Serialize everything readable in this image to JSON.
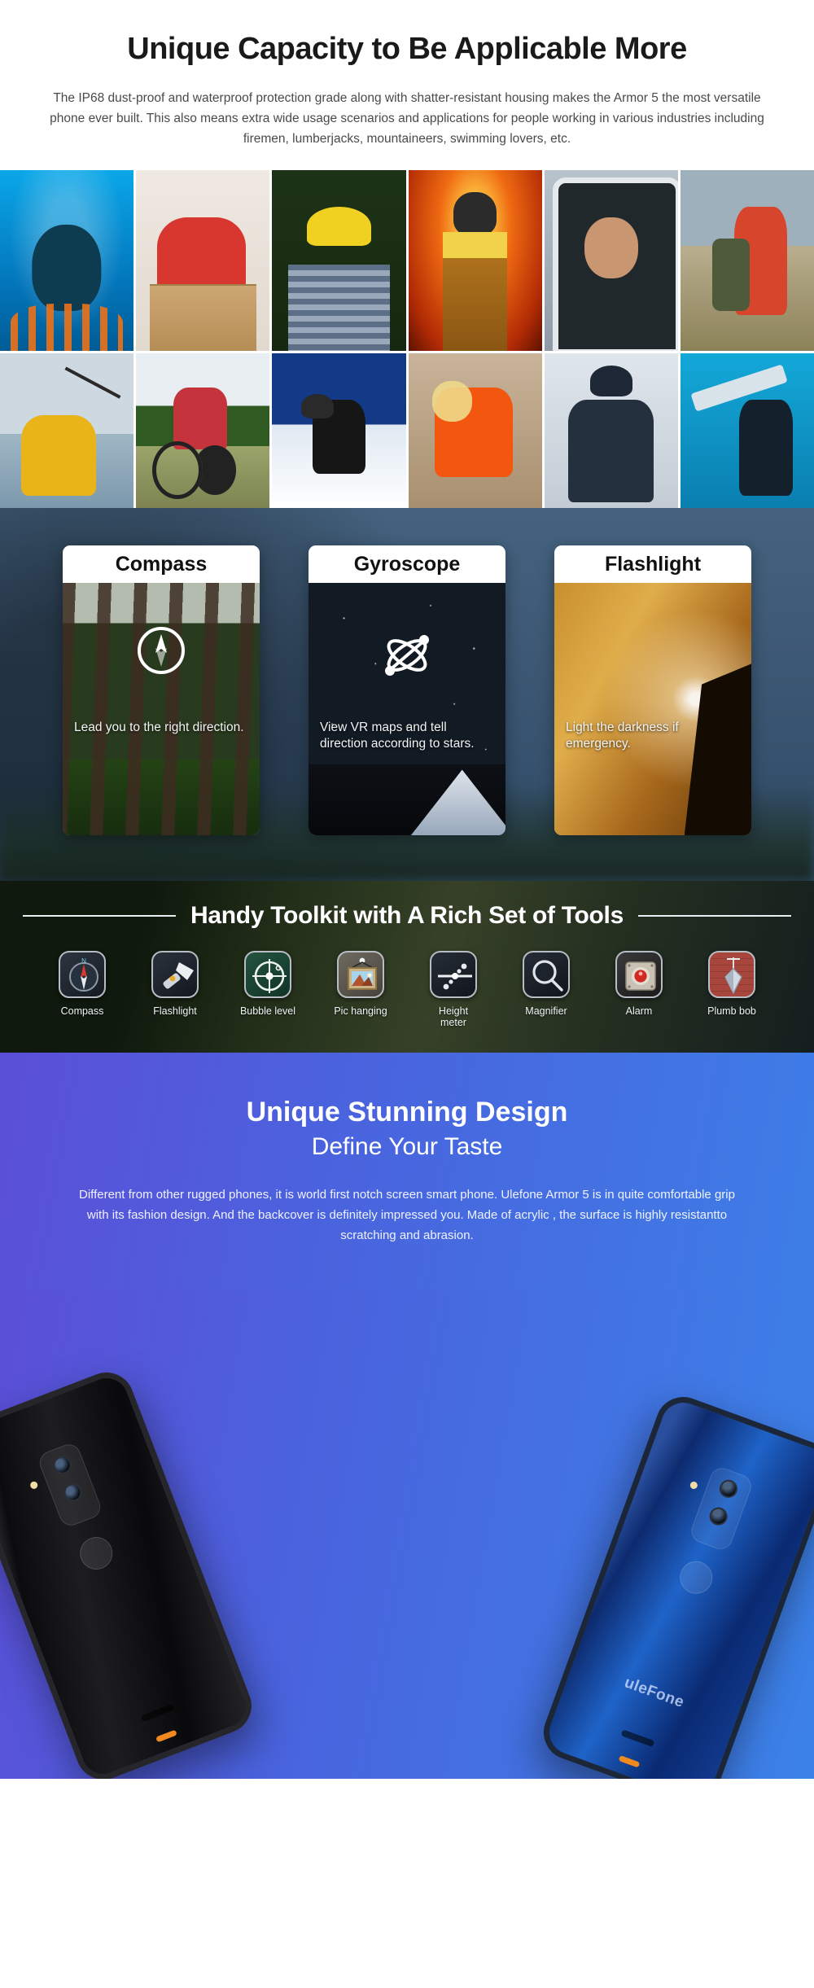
{
  "intro": {
    "title": "Unique Capacity to Be Applicable More",
    "paragraph": "The IP68 dust-proof and waterproof protection grade along with shatter-resistant housing makes the Armor 5 the most versatile phone ever built. This also means extra wide usage scenarios and applications for people working in various industries including firemen, lumberjacks, mountaineers, swimming lovers, etc."
  },
  "photo_grid": {
    "rows": [
      [
        {
          "name": "scuba-diver-photo",
          "alt": "Scuba diver underwater"
        },
        {
          "name": "delivery-worker-photo",
          "alt": "Delivery man holding box"
        },
        {
          "name": "lumberjack-photo",
          "alt": "Lumberjack with chainsaw and hard hat"
        },
        {
          "name": "firefighter-photo",
          "alt": "Firefighter in flames"
        },
        {
          "name": "driver-photo",
          "alt": "Smiling driver in truck cab"
        },
        {
          "name": "mountaineer-photo",
          "alt": "Hiker photographing mountains"
        }
      ],
      [
        {
          "name": "fisherman-photo",
          "alt": "Fisherman casting in rain"
        },
        {
          "name": "cyclist-photo",
          "alt": "Cyclist riding road bike"
        },
        {
          "name": "skier-photo",
          "alt": "Skier on snowy slope"
        },
        {
          "name": "rescue-worker-photo",
          "alt": "Rescue worker in orange suit"
        },
        {
          "name": "mechanic-photo",
          "alt": "Mechanic with thumbs up"
        },
        {
          "name": "windsurfer-photo",
          "alt": "Windsurfer on board"
        }
      ]
    ]
  },
  "sensors": {
    "cards": [
      {
        "title": "Compass",
        "copy": "Lead you to the right direction.",
        "icon": "compass-icon"
      },
      {
        "title": "Gyroscope",
        "copy": "View VR maps and tell direction according to stars.",
        "icon": "gyroscope-icon"
      },
      {
        "title": "Flashlight",
        "copy": "Light the darkness if emergency.",
        "icon": "flashlight-beam-icon"
      }
    ]
  },
  "toolkit": {
    "title": "Handy Toolkit with A Rich Set of Tools",
    "tools": [
      {
        "label": "Compass",
        "icon": "compass-app-icon"
      },
      {
        "label": "Flashlight",
        "icon": "flashlight-app-icon"
      },
      {
        "label": "Bubble level",
        "icon": "bubble-level-app-icon"
      },
      {
        "label": "Pic hanging",
        "icon": "picture-hanging-app-icon"
      },
      {
        "label": "Height meter",
        "icon": "height-meter-app-icon"
      },
      {
        "label": "Magnifier",
        "icon": "magnifier-app-icon"
      },
      {
        "label": "Alarm",
        "icon": "alarm-app-icon"
      },
      {
        "label": "Plumb bob",
        "icon": "plumb-bob-app-icon"
      }
    ]
  },
  "design": {
    "title": "Unique Stunning Design",
    "subtitle": "Define Your Taste",
    "paragraph": "Different from other rugged phones, it is world first notch screen smart phone. Ulefone Armor 5 is in quite comfortable grip with its fashion design. And the backcover is definitely impressed you. Made of acrylic , the surface is highly resistantto scratching and abrasion.",
    "phones": [
      {
        "name": "phone-black",
        "color_label": "black",
        "brand": ""
      },
      {
        "name": "phone-blue",
        "color_label": "blue",
        "brand": "uleFone"
      }
    ]
  },
  "colors": {
    "accent_orange": "#f08a1e",
    "design_gradient_start": "#5b4fd8",
    "design_gradient_end": "#3b82e8",
    "sensor_band": "#3d5874"
  }
}
